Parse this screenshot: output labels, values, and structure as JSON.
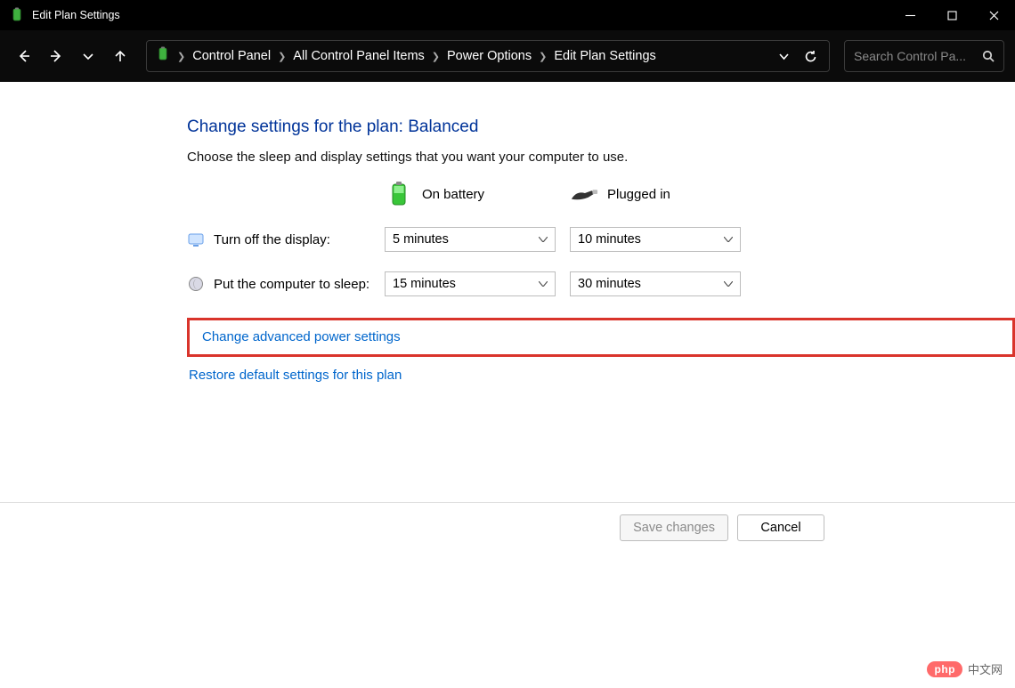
{
  "window": {
    "title": "Edit Plan Settings"
  },
  "breadcrumbs": {
    "b0": "Control Panel",
    "b1": "All Control Panel Items",
    "b2": "Power Options",
    "b3": "Edit Plan Settings"
  },
  "search": {
    "placeholder": "Search Control Pa..."
  },
  "page": {
    "heading": "Change settings for the plan: Balanced",
    "subtext": "Choose the sleep and display settings that you want your computer to use.",
    "col_battery": "On battery",
    "col_plugged": "Plugged in",
    "row_display_label": "Turn off the display:",
    "row_sleep_label": "Put the computer to sleep:",
    "display_battery_value": "5 minutes",
    "display_plugged_value": "10 minutes",
    "sleep_battery_value": "15 minutes",
    "sleep_plugged_value": "30 minutes",
    "link_advanced": "Change advanced power settings",
    "link_restore": "Restore default settings for this plan",
    "btn_save": "Save changes",
    "btn_cancel": "Cancel"
  },
  "watermark": {
    "pill": "php",
    "text": "中文网"
  }
}
